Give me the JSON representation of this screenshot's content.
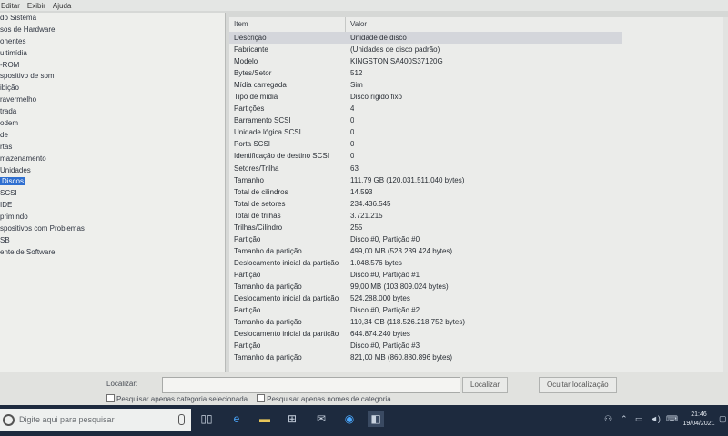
{
  "menu": [
    "Editar",
    "Exibir",
    "Ajuda"
  ],
  "tree": [
    {
      "label": "do Sistema"
    },
    {
      "label": "sos de Hardware"
    },
    {
      "label": "onentes"
    },
    {
      "label": "ultimídia"
    },
    {
      "label": "-ROM"
    },
    {
      "label": "spositivo de som"
    },
    {
      "label": "ibição"
    },
    {
      "label": "ravermelho"
    },
    {
      "label": "trada"
    },
    {
      "label": "odem"
    },
    {
      "label": "de"
    },
    {
      "label": "rtas"
    },
    {
      "label": "mazenamento"
    },
    {
      "label": "Unidades"
    },
    {
      "label": "Discos",
      "selected": true
    },
    {
      "label": "SCSI"
    },
    {
      "label": "IDE"
    },
    {
      "label": "primindo"
    },
    {
      "label": "spositivos com Problemas"
    },
    {
      "label": "SB"
    },
    {
      "label": "ente de Software"
    }
  ],
  "list": {
    "header_item": "Item",
    "header_value": "Valor",
    "rows": [
      {
        "k": "Descrição",
        "v": "Unidade de disco",
        "selected": true
      },
      {
        "k": "Fabricante",
        "v": "(Unidades de disco padrão)"
      },
      {
        "k": "Modelo",
        "v": "KINGSTON SA400S37120G"
      },
      {
        "k": "Bytes/Setor",
        "v": "512"
      },
      {
        "k": "Mídia carregada",
        "v": "Sim"
      },
      {
        "k": "Tipo de mídia",
        "v": "Disco rígido fixo"
      },
      {
        "k": "Partições",
        "v": "4"
      },
      {
        "k": "Barramento SCSI",
        "v": "0"
      },
      {
        "k": "Unidade lógica SCSI",
        "v": "0"
      },
      {
        "k": "Porta SCSI",
        "v": "0"
      },
      {
        "k": "Identificação de destino SCSI",
        "v": "0"
      },
      {
        "k": "Setores/Trilha",
        "v": "63"
      },
      {
        "k": "Tamanho",
        "v": "111,79 GB (120.031.511.040 bytes)"
      },
      {
        "k": "Total de cilindros",
        "v": "14.593"
      },
      {
        "k": "Total de setores",
        "v": "234.436.545"
      },
      {
        "k": "Total de trilhas",
        "v": "3.721.215"
      },
      {
        "k": "Trilhas/Cilindro",
        "v": "255"
      },
      {
        "k": "Partição",
        "v": "Disco #0, Partição #0"
      },
      {
        "k": "Tamanho da partição",
        "v": "499,00 MB (523.239.424 bytes)"
      },
      {
        "k": "Deslocamento inicial da partição",
        "v": "1.048.576 bytes"
      },
      {
        "k": "Partição",
        "v": "Disco #0, Partição #1"
      },
      {
        "k": "Tamanho da partição",
        "v": "99,00 MB (103.809.024 bytes)"
      },
      {
        "k": "Deslocamento inicial da partição",
        "v": "524.288.000 bytes"
      },
      {
        "k": "Partição",
        "v": "Disco #0, Partição #2"
      },
      {
        "k": "Tamanho da partição",
        "v": "110,34 GB (118.526.218.752 bytes)"
      },
      {
        "k": "Deslocamento inicial da partição",
        "v": "644.874.240 bytes"
      },
      {
        "k": "Partição",
        "v": "Disco #0, Partição #3"
      },
      {
        "k": "Tamanho da partição",
        "v": "821,00 MB (860.880.896 bytes)"
      }
    ]
  },
  "find": {
    "label": "Localizar:",
    "input_value": "",
    "find_button": "Localizar",
    "close_button": "Ocultar localização",
    "checkbox_category": "Pesquisar apenas categoria selecionada",
    "checkbox_names": "Pesquisar apenas nomes de categoria"
  },
  "taskbar": {
    "search_placeholder": "Digite aqui para pesquisar",
    "time": "21:46",
    "date": "19/04/2021"
  }
}
